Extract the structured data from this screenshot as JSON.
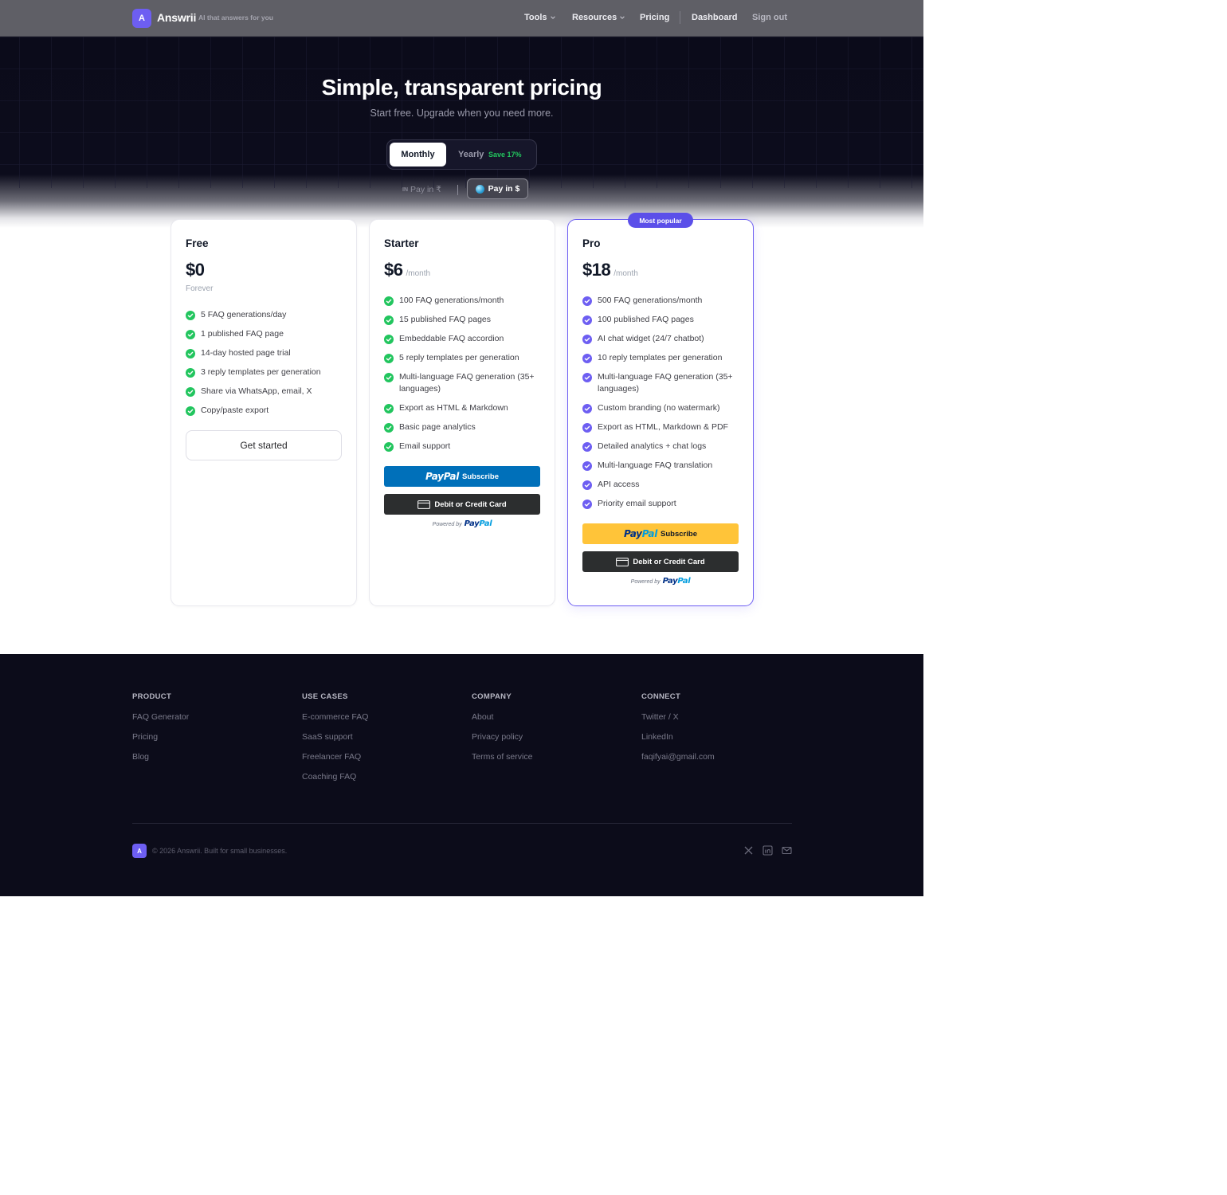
{
  "header": {
    "logo_letter": "A",
    "brand": "Answrii",
    "tagline": "AI that answers for you",
    "nav": {
      "tools": "Tools",
      "resources": "Resources",
      "pricing": "Pricing",
      "dashboard": "Dashboard",
      "sign_out": "Sign out"
    }
  },
  "hero": {
    "title": "Simple, transparent pricing",
    "subtitle": "Start free. Upgrade when you need more.",
    "billing": {
      "monthly": "Monthly",
      "yearly": "Yearly",
      "save": "Save 17%",
      "selected": "Monthly"
    },
    "currency": {
      "inr_flag": "IN",
      "inr": "Pay in ₹",
      "usd": "Pay in $",
      "selected": "USD"
    }
  },
  "plans": [
    {
      "name": "Free",
      "price": "$0",
      "note": "Forever",
      "features": [
        "5 FAQ generations/day",
        "1 published FAQ page",
        "14-day hosted page trial",
        "3 reply templates per generation",
        "Share via WhatsApp, email, X",
        "Copy/paste export"
      ],
      "cta": "Get started"
    },
    {
      "name": "Starter",
      "price": "$6",
      "period": "/month",
      "features": [
        "100 FAQ generations/month",
        "15 published FAQ pages",
        "Embeddable FAQ accordion",
        "5 reply templates per generation",
        "Multi-language FAQ generation (35+ languages)",
        "Export as HTML & Markdown",
        "Basic page analytics",
        "Email support"
      ],
      "paypal": {
        "logo_a": "Pay",
        "logo_b": "Pal",
        "label": "Subscribe"
      },
      "card_label": "Debit or Credit Card",
      "powered_by": "Powered by"
    },
    {
      "name": "Pro",
      "badge": "Most popular",
      "price": "$18",
      "period": "/month",
      "features": [
        "500 FAQ generations/month",
        "100 published FAQ pages",
        "AI chat widget (24/7 chatbot)",
        "10 reply templates per generation",
        "Multi-language FAQ generation (35+ languages)",
        "Custom branding (no watermark)",
        "Export as HTML, Markdown & PDF",
        "Detailed analytics + chat logs",
        "Multi-language FAQ translation",
        "API access",
        "Priority email support"
      ],
      "paypal": {
        "logo_a": "Pay",
        "logo_b": "Pal",
        "label": "Subscribe"
      },
      "card_label": "Debit or Credit Card",
      "powered_by": "Powered by"
    }
  ],
  "colors": {
    "accent": "#6d5ef2",
    "check_green": "#22c55e",
    "check_purple": "#6d5ef2",
    "paypal_blue": "#0070ba",
    "paypal_gold": "#ffc439"
  },
  "footer": {
    "columns": [
      {
        "title": "PRODUCT",
        "links": [
          "FAQ Generator",
          "Pricing",
          "Blog"
        ]
      },
      {
        "title": "USE CASES",
        "links": [
          "E-commerce FAQ",
          "SaaS support",
          "Freelancer FAQ",
          "Coaching FAQ"
        ]
      },
      {
        "title": "COMPANY",
        "links": [
          "About",
          "Privacy policy",
          "Terms of service"
        ]
      },
      {
        "title": "CONNECT",
        "links": [
          "Twitter / X",
          "LinkedIn",
          "faqifyai@gmail.com"
        ]
      }
    ],
    "logo_letter": "A",
    "copyright": "© 2026 Answrii. Built for small businesses.",
    "social_icons": [
      "x-icon",
      "linkedin-icon",
      "mail-icon"
    ]
  }
}
